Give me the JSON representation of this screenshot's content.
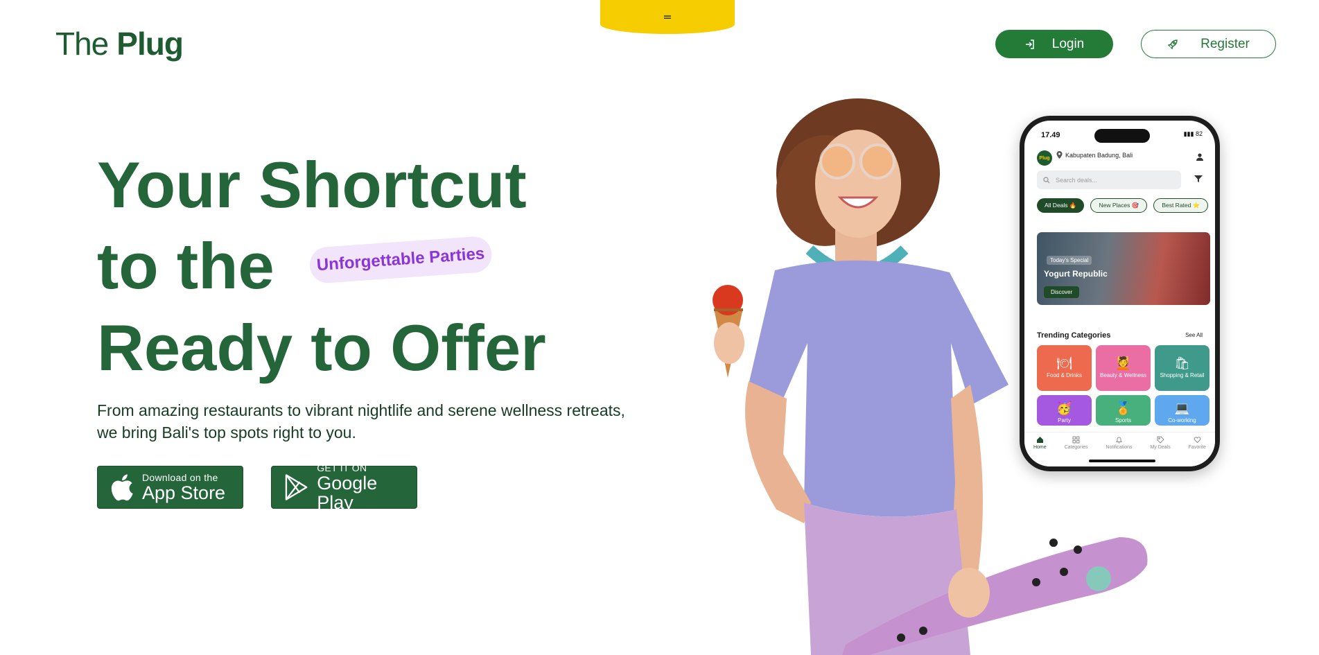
{
  "nav": {
    "menu_glyph": "=",
    "logo_part1": "The",
    "logo_part2": "Plug",
    "login_label": "Login",
    "register_label": "Register"
  },
  "hero": {
    "line1": "Your Shortcut",
    "line2": "to the",
    "line3": "Ready to Offer",
    "rotating_tag": "Unforgettable Parties",
    "subtitle_line1": "From amazing restaurants to vibrant nightlife and serene wellness retreats,",
    "subtitle_line2": "we bring Bali's top spots right to you."
  },
  "stores": {
    "app_store_small": "Download on the",
    "app_store_big": "App Store",
    "google_small": "GET IT ON",
    "google_big": "Google Play"
  },
  "phone": {
    "time": "17.49",
    "battery": "82",
    "logo": "Plug",
    "location": "Kabupaten Badung, Bali",
    "search_placeholder": "Search deals...",
    "chips": [
      "All Deals 🔥",
      "New Places 🎯",
      "Best Rated ⭐"
    ],
    "banner": {
      "tag": "Today's Special",
      "name": "Yogurt Republic",
      "button": "Discover"
    },
    "trending_title": "Trending Categories",
    "see_all": "See All",
    "categories": [
      "Food & Drinks",
      "Beauty & Wellness",
      "Shopping & Retail",
      "Party",
      "Sports",
      "Co-working"
    ],
    "tabs": [
      "Home",
      "Categories",
      "Notifications",
      "My Deals",
      "Favorite"
    ]
  },
  "colors": {
    "brand_green": "#24653a",
    "accent_yellow": "#f5cd00",
    "tag_purple": "#8a36d6"
  }
}
